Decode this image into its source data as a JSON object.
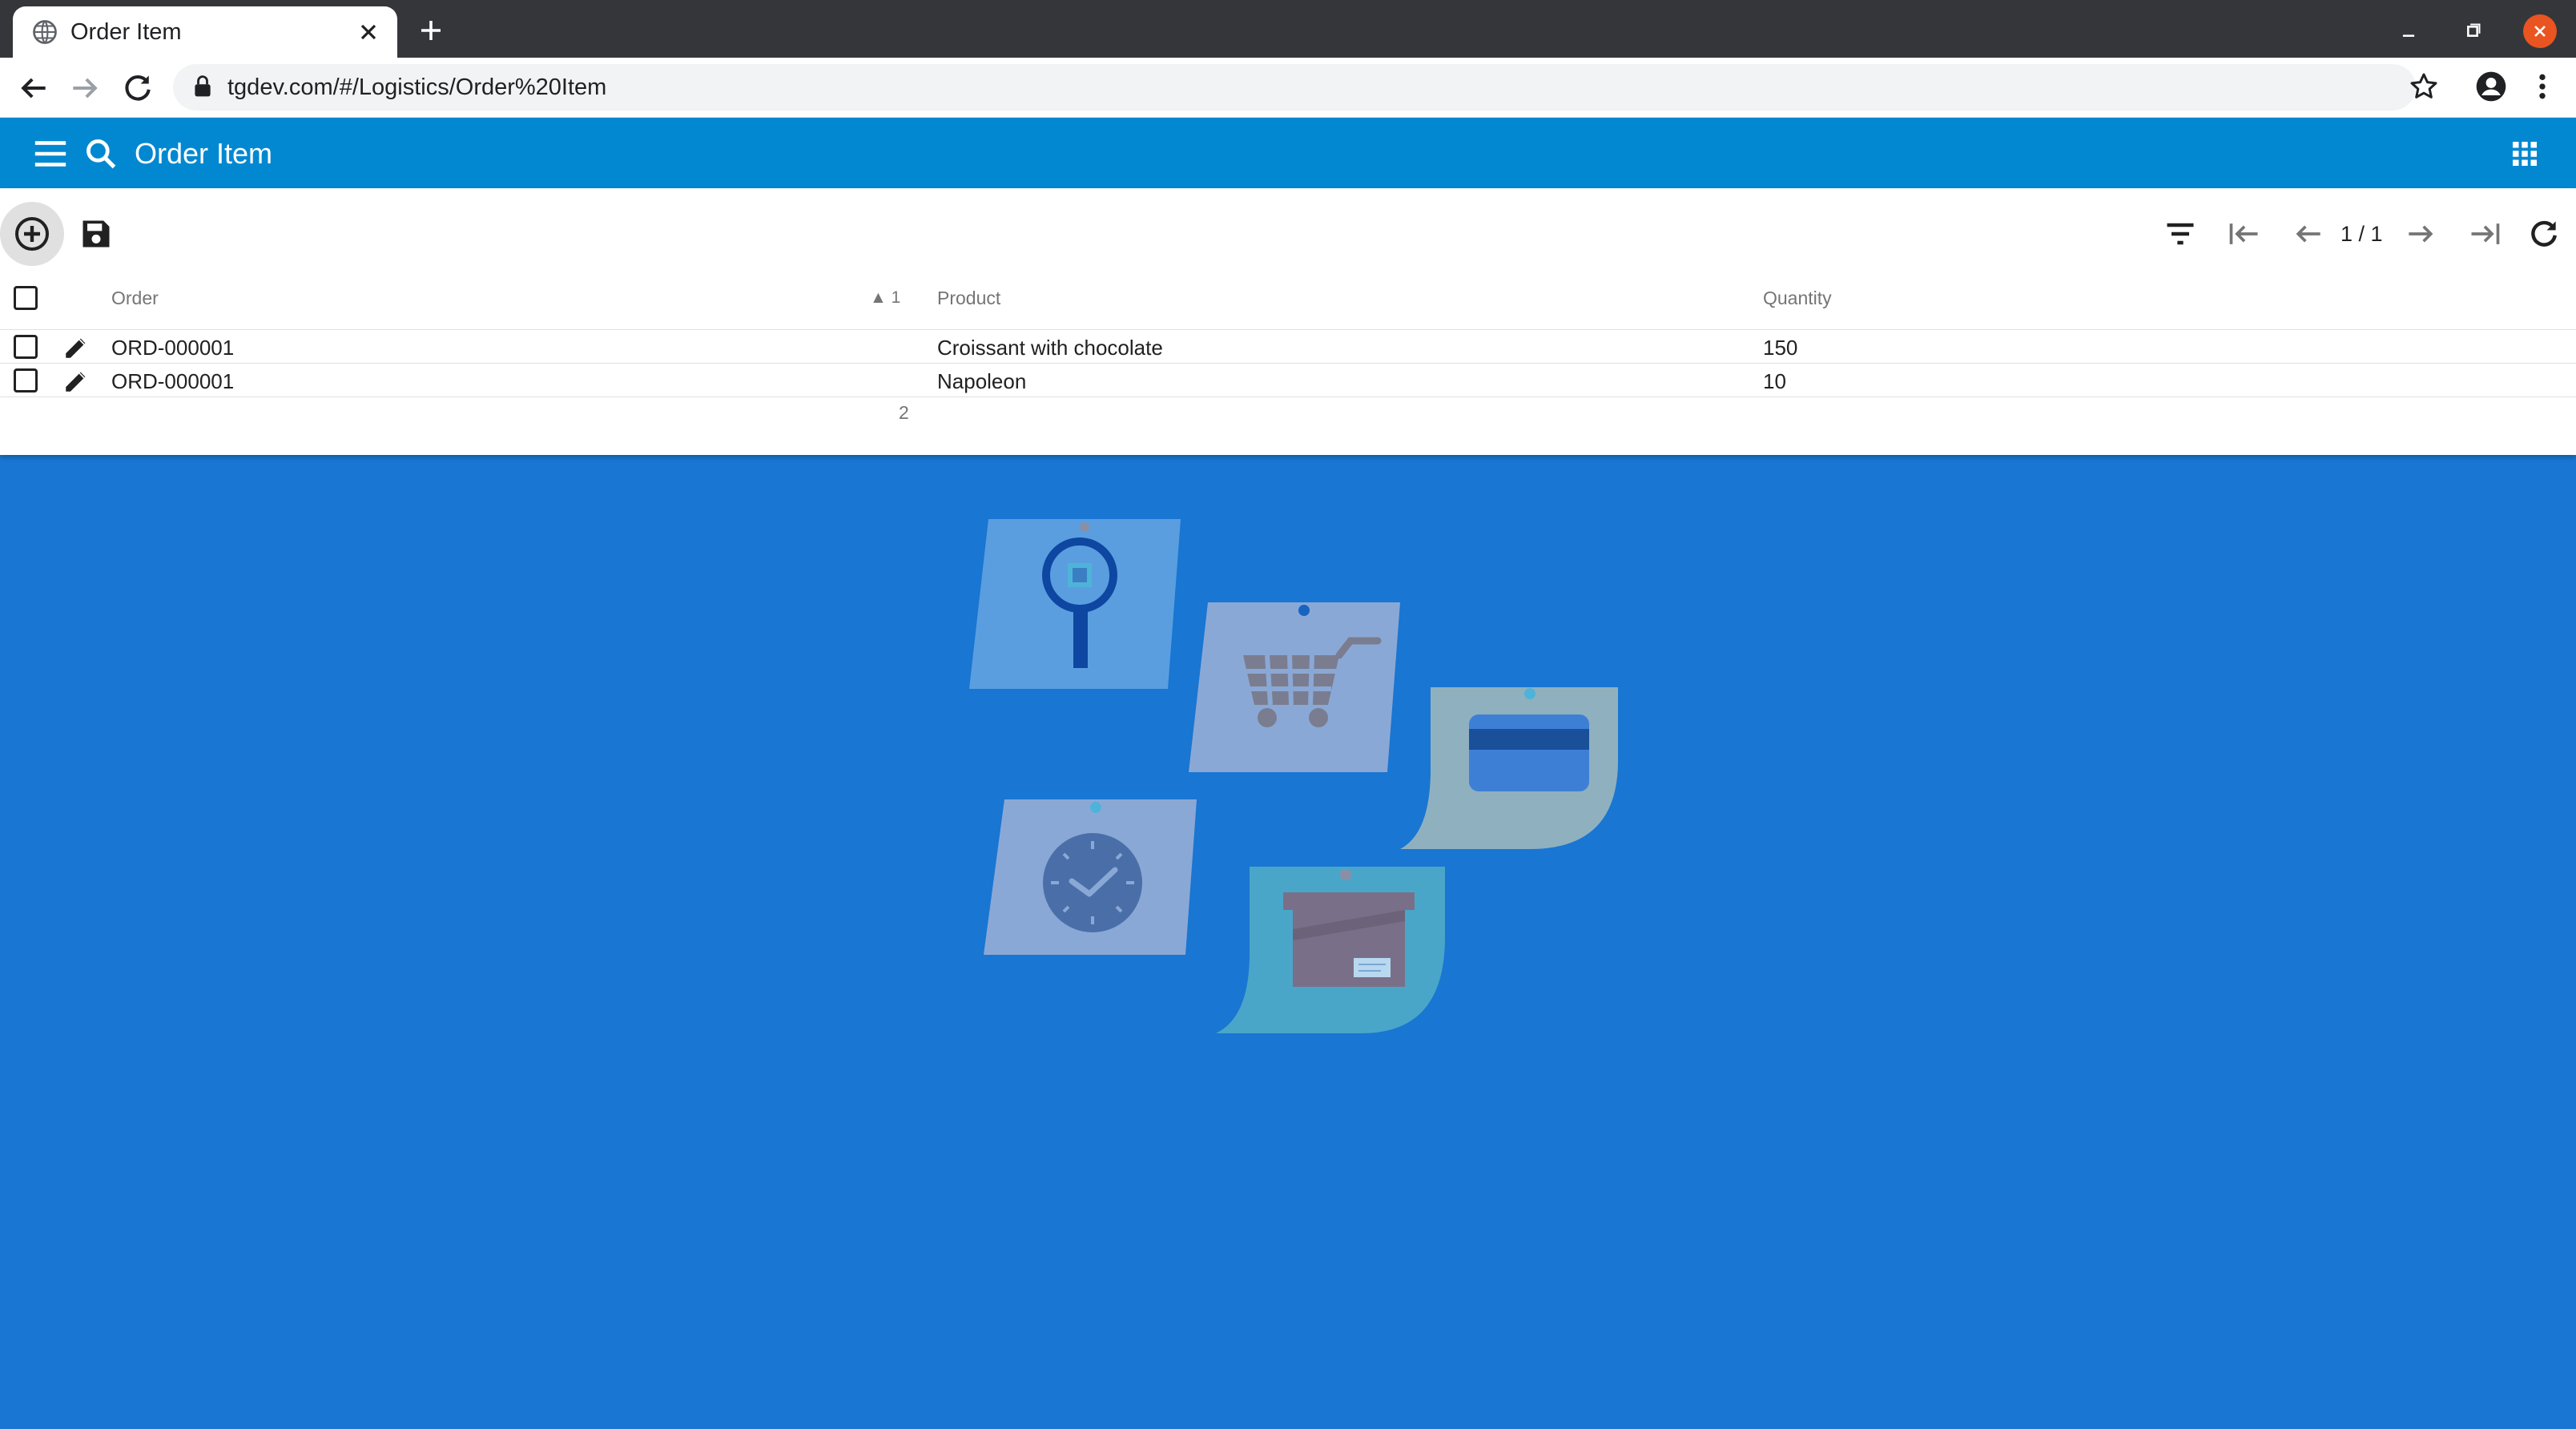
{
  "browser": {
    "tab_title": "Order Item",
    "url": "tgdev.com/#/Logistics/Order%20Item"
  },
  "app": {
    "title": "Order Item",
    "header_color": "#0288d1",
    "background_color": "#1976d2"
  },
  "toolbar": {
    "pagination": "1 / 1"
  },
  "grid": {
    "columns": [
      {
        "label": "Order",
        "sort": "ascending",
        "sort_order": "1"
      },
      {
        "label": "Product"
      },
      {
        "label": "Quantity"
      }
    ],
    "rows": [
      {
        "order": "ORD-000001",
        "product": "Croissant with chocolate",
        "quantity": "150"
      },
      {
        "order": "ORD-000001",
        "product": "Napoleon",
        "quantity": "10"
      }
    ],
    "row_count": "2"
  },
  "icons": [
    "globe-icon",
    "close-icon",
    "plus-icon",
    "back-icon",
    "forward-icon",
    "reload-icon",
    "lock-icon",
    "star-icon",
    "profile-icon",
    "more-vert-icon",
    "menu-icon",
    "search-icon",
    "apps-icon",
    "add-circle-icon",
    "save-icon",
    "filter-icon",
    "first-page-icon",
    "prev-page-icon",
    "next-page-icon",
    "last-page-icon",
    "refresh-icon",
    "edit-icon"
  ]
}
